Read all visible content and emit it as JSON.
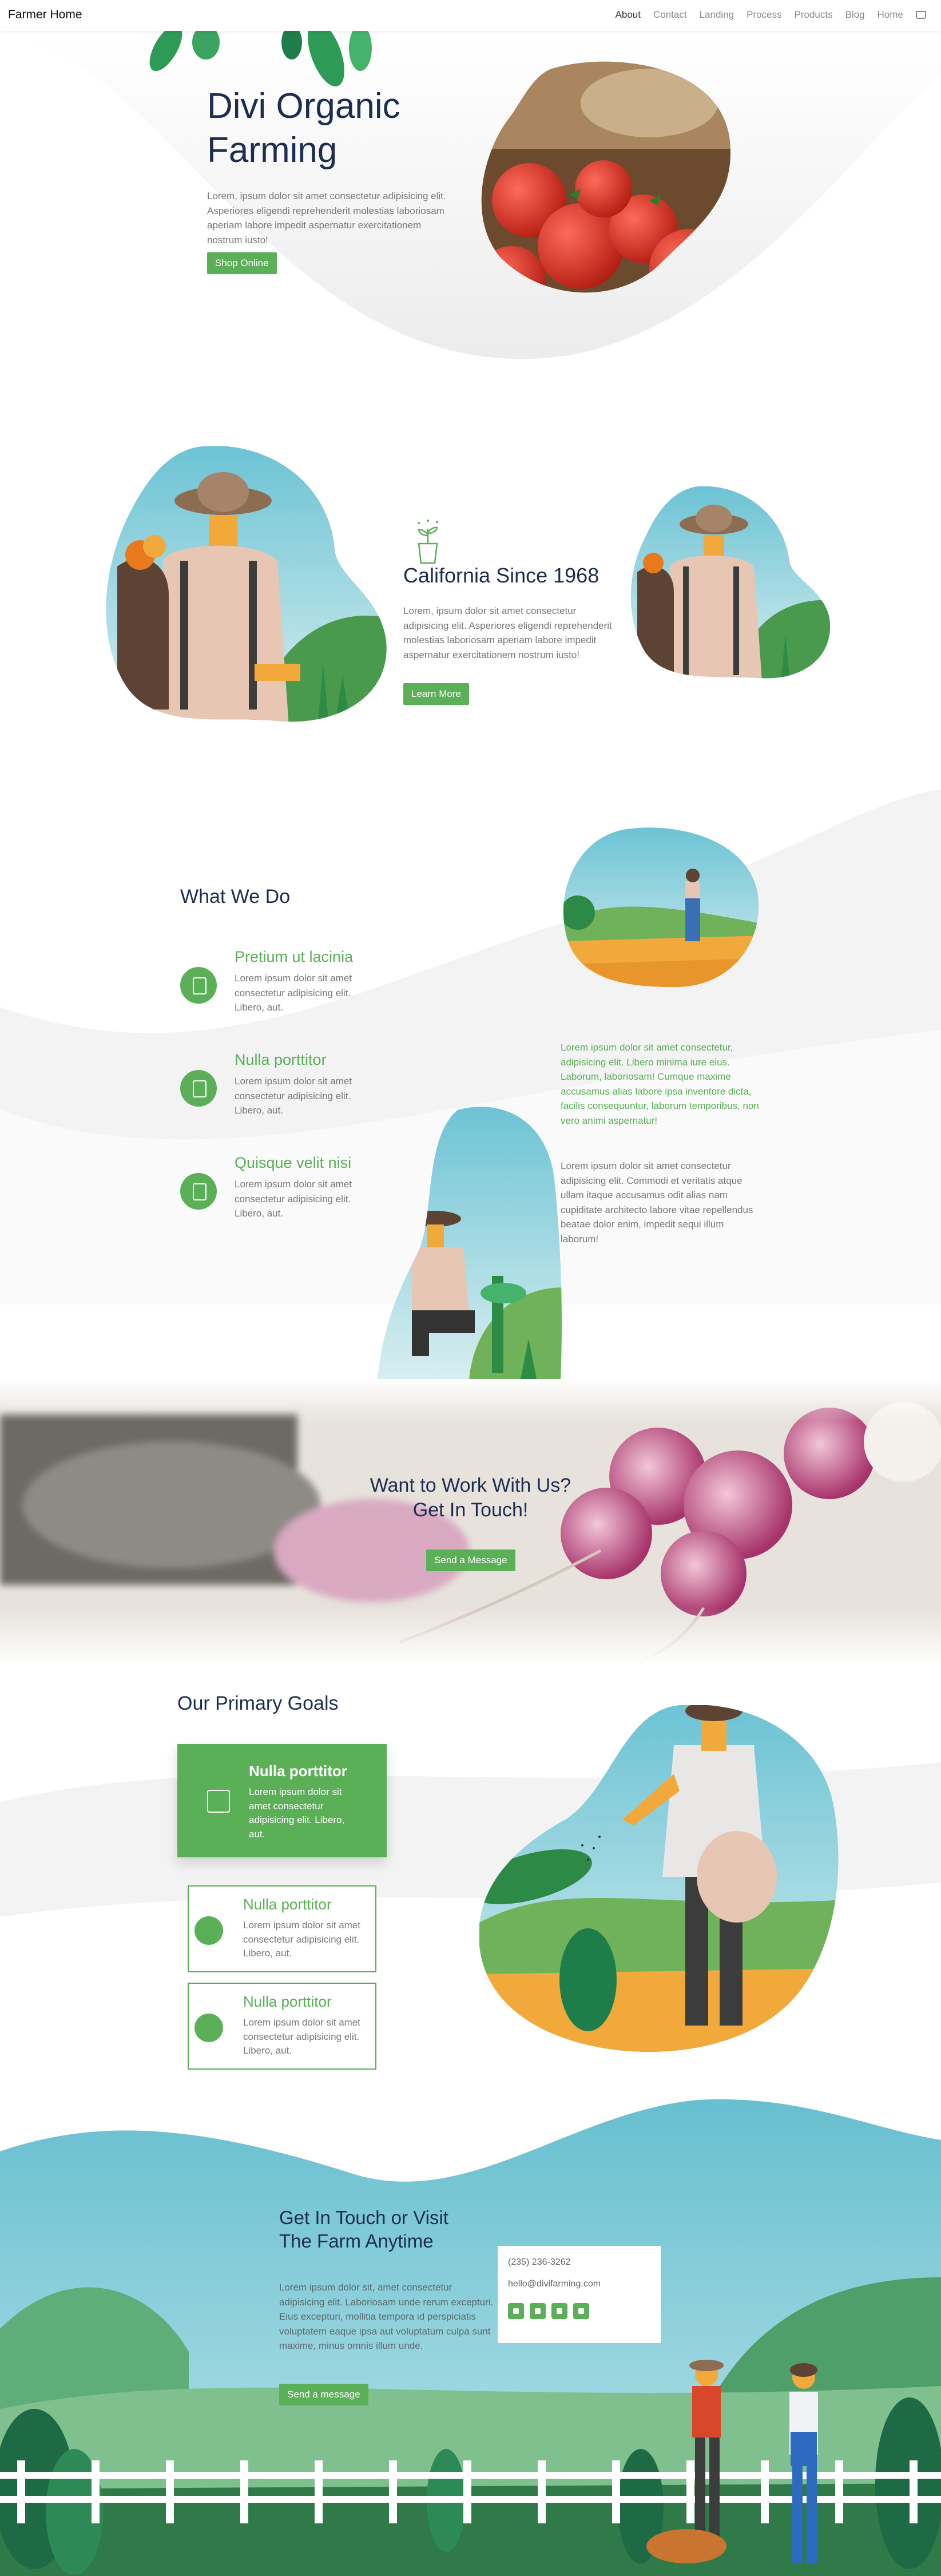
{
  "header": {
    "brand": "Farmer Home",
    "nav": [
      "About",
      "Contact",
      "Landing",
      "Process",
      "Products",
      "Blog",
      "Home"
    ],
    "cart_icon": "cart-icon"
  },
  "hero": {
    "title_line1": "Divi Organic",
    "title_line2": "Farming",
    "text": "Lorem, ipsum dolor sit amet consectetur adipisicing elit. Asperiores eligendi reprehenderit molestias laboriosam aperiam labore impedit aspernatur exercitationem nostrum iusto!",
    "button": "Shop Online"
  },
  "california": {
    "title": "California Since 1968",
    "text": "Lorem, ipsum dolor sit amet consectetur adipisicing elit. Asperiores eligendi reprehenderit molestias laboriosam aperiam labore impedit aspernatur exercitationem nostrum iusto!",
    "button": "Learn More"
  },
  "what_we_do": {
    "title": "What We Do",
    "features": [
      {
        "title": "Pretium ut lacinia",
        "text": "Lorem ipsum dolor sit amet consectetur adipisicing elit. Libero, aut."
      },
      {
        "title": "Nulla porttitor",
        "text": "Lorem ipsum dolor sit amet consectetur adipisicing elit. Libero, aut."
      },
      {
        "title": "Quisque velit nisi",
        "text": "Lorem ipsum dolor sit amet consectetur adipisicing elit. Libero, aut."
      }
    ],
    "green_text": "Lorem ipsum dolor sit amet consectetur, adipisicing elit. Libero minima iure eius. Laborum, laboriosam! Cumque maxime accusamus alias labore ipsa inventore dicta, facilis consequuntur, laborum temporibus, non vero animi aspernatur!",
    "gray_text": "Lorem ipsum dolor sit amet consectetur adipisicing elit. Commodi et veritatis atque ullam itaque accusamus odit alias nam cupiditate architecto labore vitae repellendus beatae dolor enim, impedit sequi illum laborum!"
  },
  "cta": {
    "title_line1": "Want to Work With Us?",
    "title_line2": "Get In Touch!",
    "button": "Send a Message"
  },
  "goals": {
    "title": "Our Primary Goals",
    "cards": [
      {
        "title": "Nulla porttitor",
        "text": "Lorem ipsum dolor sit amet consectetur adipisicing elit. Libero, aut."
      },
      {
        "title": "Nulla porttitor",
        "text": "Lorem ipsum dolor sit amet consectetur adipisicing elit. Libero, aut."
      },
      {
        "title": "Nulla porttitor",
        "text": "Lorem ipsum dolor sit amet consectetur adipisicing elit. Libero, aut."
      }
    ]
  },
  "contact": {
    "title_line1": "Get In Touch or Visit",
    "title_line2": "The Farm Anytime",
    "text": "Lorem ipsum dolor sit, amet consectetur adipisicing elit. Laboriosam unde rerum excepturi. Eius excepturi, mollitia tempora id perspiciatis voluptatem eaque ipsa aut voluptatum culpa sunt maxime, minus omnis illum unde.",
    "button": "Send a message",
    "phone": "(235) 236-3262",
    "email": "hello@divifarming.com",
    "socials": [
      "facebook-icon",
      "twitter-icon",
      "instagram-icon",
      "youtube-icon"
    ]
  },
  "colors": {
    "accent": "#5aaf57",
    "heading": "#1d2d50",
    "sky": "#7ec9d6"
  }
}
